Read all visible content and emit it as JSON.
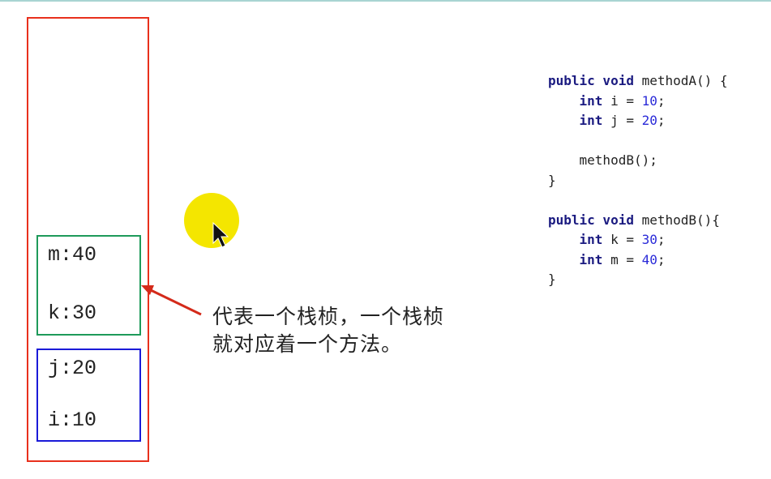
{
  "stack_frames": {
    "method_b_frame": {
      "vars": [
        "m:40",
        "k:30"
      ],
      "color": "#1e9a5a"
    },
    "method_a_frame": {
      "vars": [
        "j:20",
        "i:10"
      ],
      "color": "#1a1ad8"
    },
    "stack_color": "#e8301c"
  },
  "annotation": {
    "line1": "代表一个栈桢，一个栈桢",
    "line2": "就对应着一个方法。"
  },
  "code": {
    "lines": [
      {
        "kw": "public void",
        "text": " methodA() {"
      },
      {
        "indent": "    ",
        "kw": "int",
        "text": " i = ",
        "num": "10",
        "end": ";"
      },
      {
        "indent": "    ",
        "kw": "int",
        "text": " j = ",
        "num": "20",
        "end": ";"
      },
      {
        "text": ""
      },
      {
        "indent": "    ",
        "text": "methodB();"
      },
      {
        "text": "}"
      },
      {
        "text": ""
      },
      {
        "kw": "public void",
        "text": " methodB(){"
      },
      {
        "indent": "    ",
        "kw": "int",
        "text": " k = ",
        "num": "30",
        "end": ";"
      },
      {
        "indent": "    ",
        "kw": "int",
        "text": " m = ",
        "num": "40",
        "end": ";"
      },
      {
        "text": "}"
      }
    ]
  },
  "icons": {
    "cursor": "mouse-pointer-icon",
    "arrow": "arrow-left-icon"
  }
}
